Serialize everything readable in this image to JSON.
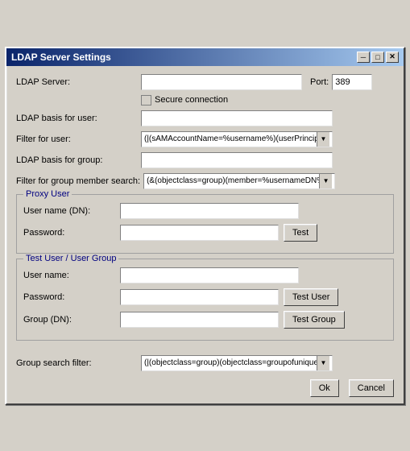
{
  "window": {
    "title": "LDAP Server Settings",
    "close_btn": "✕",
    "minimize_btn": "─",
    "maximize_btn": "□"
  },
  "form": {
    "ldap_server_label": "LDAP Server:",
    "ldap_server_value": "",
    "port_label": "Port:",
    "port_value": "389",
    "secure_label": "Secure connection",
    "ldap_basis_user_label": "LDAP basis for user:",
    "ldap_basis_user_value": "",
    "filter_user_label": "Filter for user:",
    "filter_user_value": "(|(sAMAccountName=%username%)(userPrincipalName=%",
    "ldap_basis_group_label": "LDAP basis for group:",
    "ldap_basis_group_value": "",
    "filter_group_label": "Filter for group member search:",
    "filter_group_value": "(&(objectclass=group)(member=%usernameDN%))"
  },
  "proxy_user": {
    "section_title": "Proxy User",
    "username_label": "User name (DN):",
    "username_value": "",
    "password_label": "Password:",
    "password_value": "",
    "test_btn": "Test"
  },
  "test_user": {
    "section_title": "Test User / User Group",
    "username_label": "User name:",
    "username_value": "",
    "password_label": "Password:",
    "password_value": "",
    "test_user_btn": "Test User",
    "group_label": "Group (DN):",
    "group_value": "",
    "test_group_btn": "Test Group"
  },
  "bottom": {
    "group_search_label": "Group search filter:",
    "group_search_value": "(|(objectclass=group)(objectclass=groupofuniquenames)",
    "ok_btn": "Ok",
    "cancel_btn": "Cancel"
  }
}
